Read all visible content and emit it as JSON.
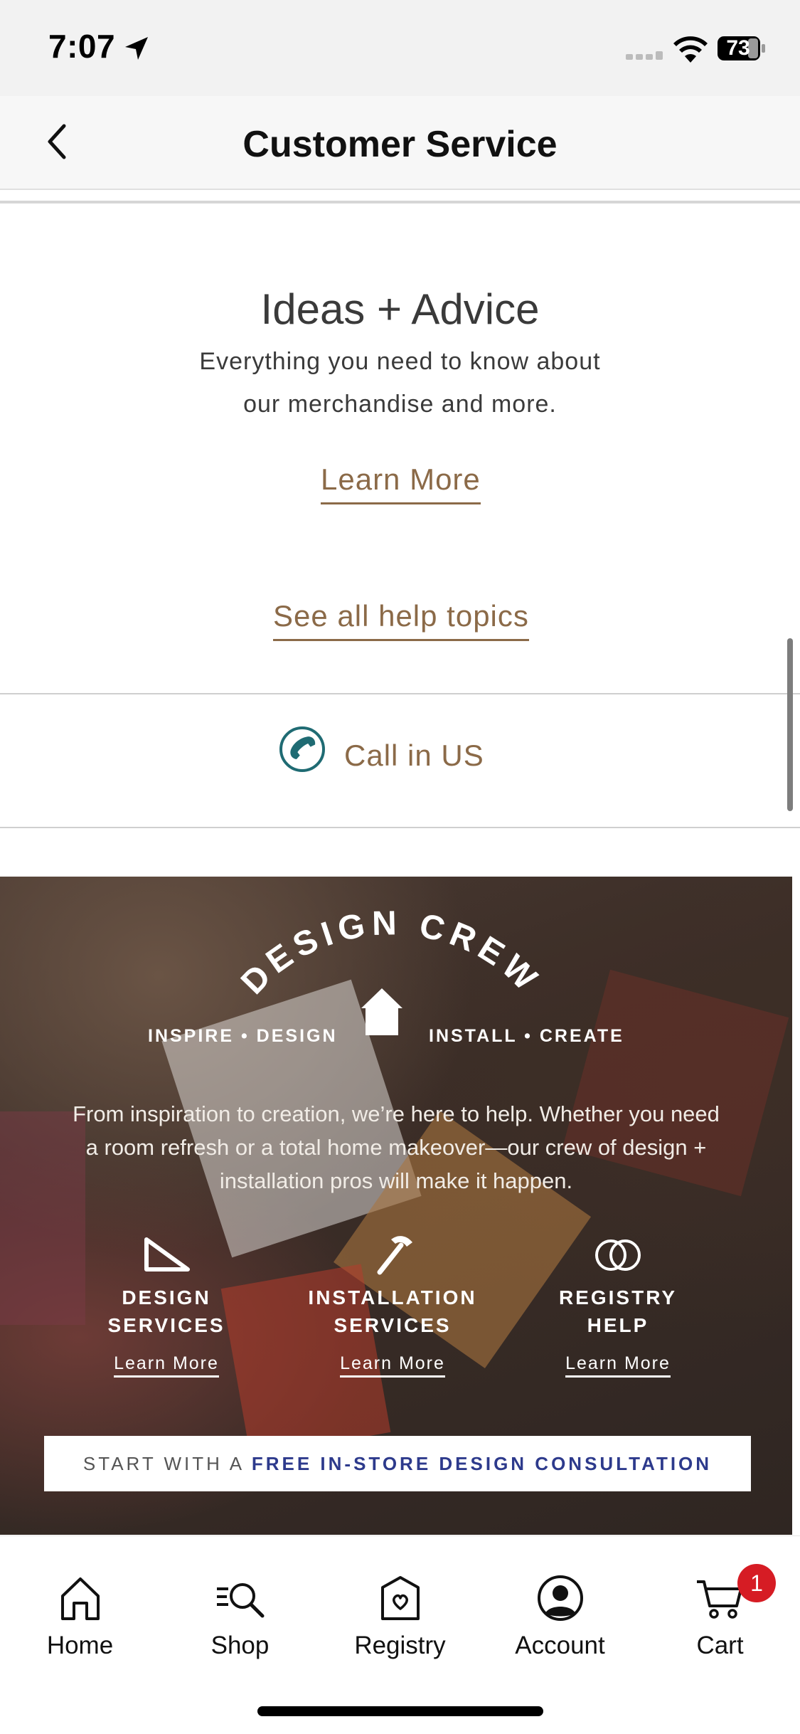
{
  "status_bar": {
    "time": "7:07",
    "battery": "73"
  },
  "nav": {
    "title": "Customer Service"
  },
  "ideas": {
    "title": "Ideas + Advice",
    "description": "Everything you need to know about our merchandise and more.",
    "learn_more": "Learn More"
  },
  "help": {
    "see_all": "See all help topics"
  },
  "call": {
    "label": "Call in US"
  },
  "banner": {
    "heading": "DESIGN CREW",
    "tagline_left": "INSPIRE • DESIGN",
    "tagline_right": "INSTALL • CREATE",
    "description": "From inspiration to creation, we’re here to help. Whether you need a room refresh or a total home makeover—our crew of design + installation pros will make it happen.",
    "services": [
      {
        "title": "DESIGN SERVICES",
        "link": "Learn More"
      },
      {
        "title": "INSTALLATION SERVICES",
        "link": "Learn More"
      },
      {
        "title": "REGISTRY HELP",
        "link": "Learn More"
      }
    ],
    "consult_prefix": "START WITH A",
    "consult_emphasis": "FREE IN-STORE DESIGN CONSULTATION"
  },
  "tabs": [
    {
      "label": "Home",
      "icon": "home-icon"
    },
    {
      "label": "Shop",
      "icon": "shop-search-icon"
    },
    {
      "label": "Registry",
      "icon": "registry-icon"
    },
    {
      "label": "Account",
      "icon": "account-icon"
    },
    {
      "label": "Cart",
      "icon": "cart-icon"
    }
  ],
  "cart_badge": "1",
  "colors": {
    "link": "#8b6a48",
    "badge": "#d61c24",
    "consult_emphasis": "#2d3a8c",
    "phone_icon": "#1f6b73"
  }
}
